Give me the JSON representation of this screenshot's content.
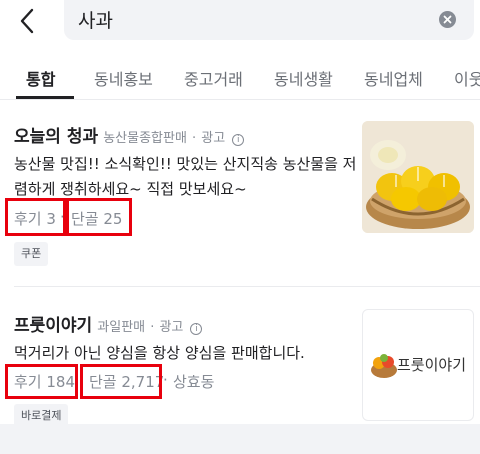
{
  "search": {
    "query": "사과",
    "back_icon": "chevron-left-icon",
    "clear_icon": "clear-x-icon"
  },
  "tabs": [
    {
      "label": "통합",
      "active": true
    },
    {
      "label": "동네홍보",
      "active": false
    },
    {
      "label": "중고거래",
      "active": false
    },
    {
      "label": "동네생활",
      "active": false
    },
    {
      "label": "동네업체",
      "active": false
    },
    {
      "label": "이웃",
      "active": false
    }
  ],
  "results": [
    {
      "name": "오늘의 청과",
      "category": "농산물종합판매",
      "ad_label": "광고",
      "description": "농산물 맛집!! 소식확인!! 맛있는 산지직송 농산물을 저렴하게 쟁취하세요~ 직접 맛보세요~",
      "reviews": "후기 3",
      "regulars": "단골 25",
      "location": "",
      "chip": "쿠폰"
    },
    {
      "name": "프룻이야기",
      "category": "과일판매",
      "ad_label": "광고",
      "description": "먹거리가 아닌 양심을 항상 양심을 판매합니다.",
      "reviews": "후기 184",
      "regulars": "단골 2,717",
      "location": "상효동",
      "chip": "바로결제",
      "logo_text": "프룻이야기"
    }
  ],
  "colors": {
    "accent_red": "#e8000d",
    "muted": "#868b94",
    "text": "#212124"
  }
}
